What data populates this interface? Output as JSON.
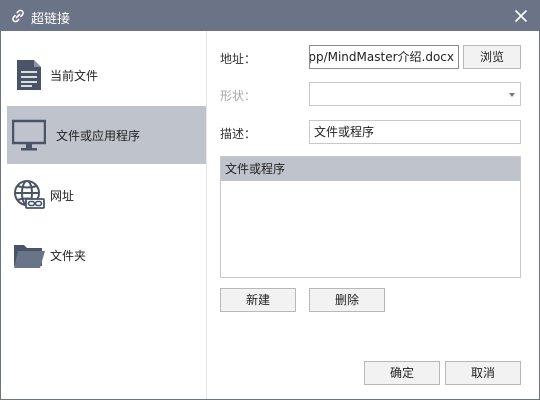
{
  "window": {
    "title": "超链接",
    "title_icon": "link-icon",
    "close_icon": "close-icon"
  },
  "sidebar": {
    "items": [
      {
        "label": "当前文件",
        "icon": "document-icon",
        "active": false
      },
      {
        "label": "文件或应用程序",
        "icon": "monitor-icon",
        "active": true
      },
      {
        "label": "网址",
        "icon": "globe-link-icon",
        "active": false
      },
      {
        "label": "文件夹",
        "icon": "folder-icon",
        "active": false
      }
    ]
  },
  "form": {
    "address_label": "地址：",
    "address_value": "pp/MindMaster介绍.docx",
    "browse_label": "浏览",
    "shape_label": "形状：",
    "shape_value": "",
    "description_label": "描述：",
    "description_value": "文件或程序"
  },
  "list": {
    "items": [
      "文件或程序"
    ]
  },
  "actions": {
    "new_label": "新建",
    "delete_label": "删除",
    "ok_label": "确定",
    "cancel_label": "取消"
  },
  "colors": {
    "titlebar": "#6b7487",
    "selection": "#bfc3cc",
    "icon": "#4a5468"
  }
}
